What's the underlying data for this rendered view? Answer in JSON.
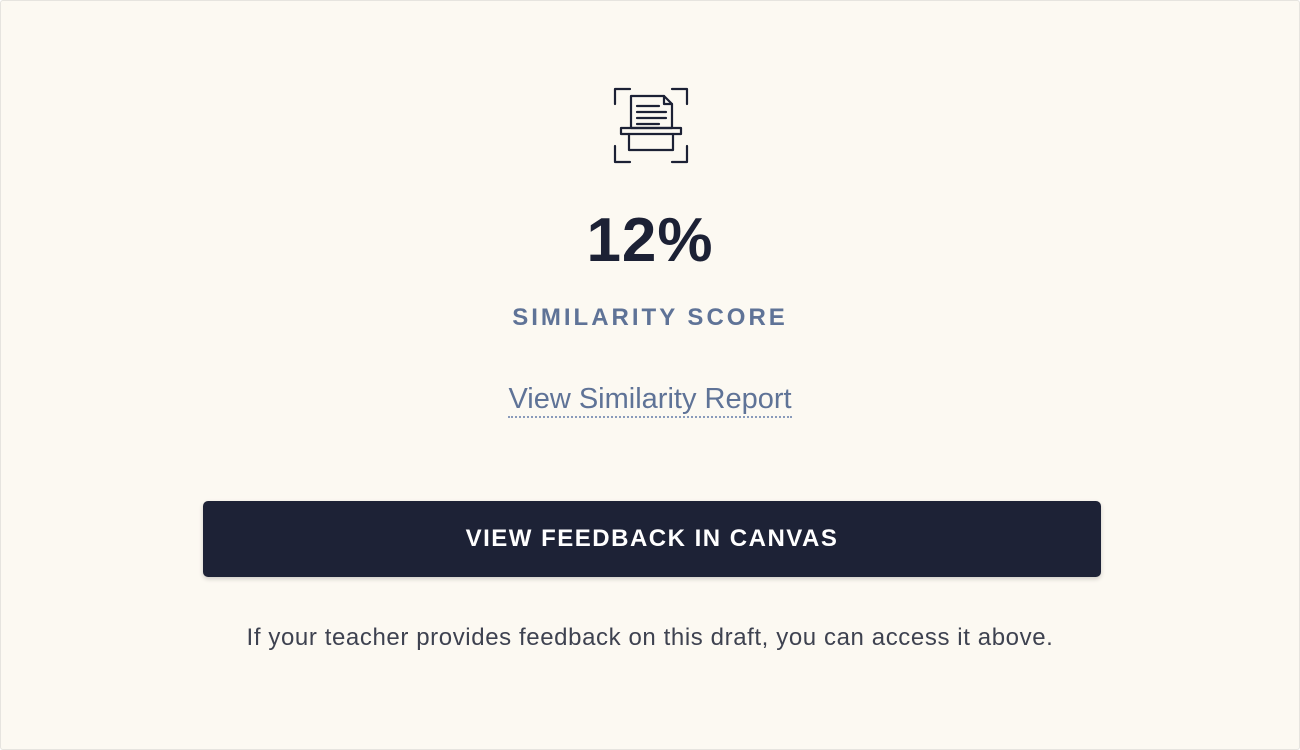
{
  "result": {
    "icon": "document-scan-icon",
    "score": "12%",
    "score_label": "SIMILARITY SCORE",
    "report_link_label": "View Similarity Report"
  },
  "actions": {
    "feedback_button_label": "VIEW FEEDBACK IN CANVAS"
  },
  "help_text": "If your teacher provides feedback on this draft, you can access it above.",
  "colors": {
    "background": "#fcf9f2",
    "primary_text": "#1c2135",
    "accent": "#5f7397",
    "button_bg": "#1d2236",
    "button_text": "#ffffff"
  }
}
